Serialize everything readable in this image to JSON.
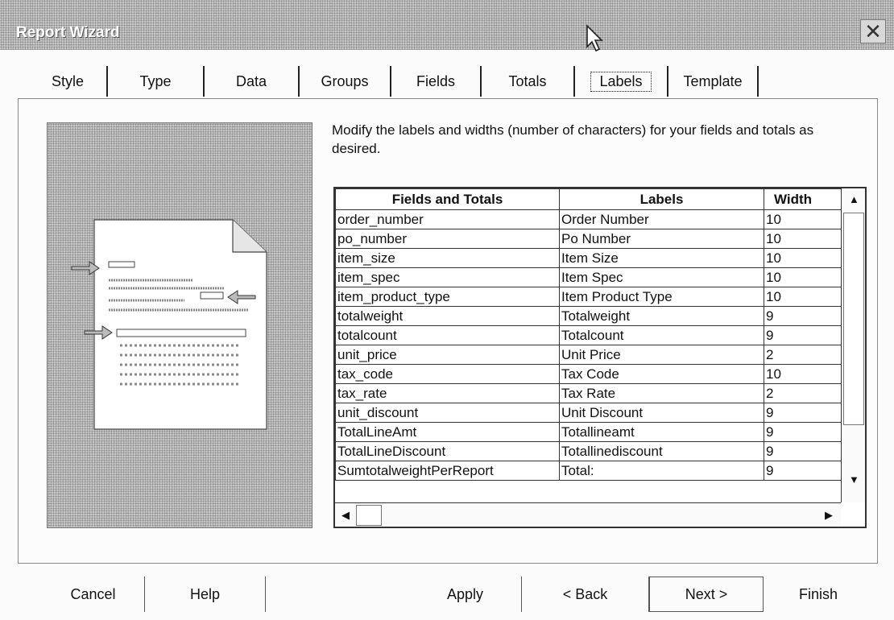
{
  "window": {
    "title": "Report Wizard"
  },
  "tabs": [
    "Style",
    "Type",
    "Data",
    "Groups",
    "Fields",
    "Totals",
    "Labels",
    "Template"
  ],
  "active_tab": "Labels",
  "description": "Modify the labels and widths (number of characters) for your fields and totals as desired.",
  "grid": {
    "headers": {
      "fields": "Fields and Totals",
      "labels": "Labels",
      "width": "Width"
    },
    "rows": [
      {
        "field": "order_number",
        "label": "Order Number",
        "width": "10"
      },
      {
        "field": "po_number",
        "label": "Po Number",
        "width": "10"
      },
      {
        "field": "item_size",
        "label": "Item Size",
        "width": "10"
      },
      {
        "field": "item_spec",
        "label": "Item Spec",
        "width": "10"
      },
      {
        "field": "item_product_type",
        "label": "Item Product Type",
        "width": "10"
      },
      {
        "field": "totalweight",
        "label": "Totalweight",
        "width": "9"
      },
      {
        "field": "totalcount",
        "label": "Totalcount",
        "width": "9"
      },
      {
        "field": "unit_price",
        "label": "Unit Price",
        "width": "2"
      },
      {
        "field": "tax_code",
        "label": "Tax Code",
        "width": "10"
      },
      {
        "field": "tax_rate",
        "label": "Tax Rate",
        "width": "2"
      },
      {
        "field": "unit_discount",
        "label": "Unit Discount",
        "width": "9"
      },
      {
        "field": "TotalLineAmt",
        "label": "Totallineamt",
        "width": "9"
      },
      {
        "field": "TotalLineDiscount",
        "label": "Totallinediscount",
        "width": "9"
      },
      {
        "field": "SumtotalweightPerReport",
        "label": "Total:",
        "width": "9"
      }
    ]
  },
  "buttons": {
    "cancel": "Cancel",
    "help": "Help",
    "apply": "Apply",
    "back": "< Back",
    "next": "Next >",
    "finish": "Finish"
  },
  "icons": {
    "close": "close-icon",
    "cursor": "cursor-arrow-icon"
  }
}
